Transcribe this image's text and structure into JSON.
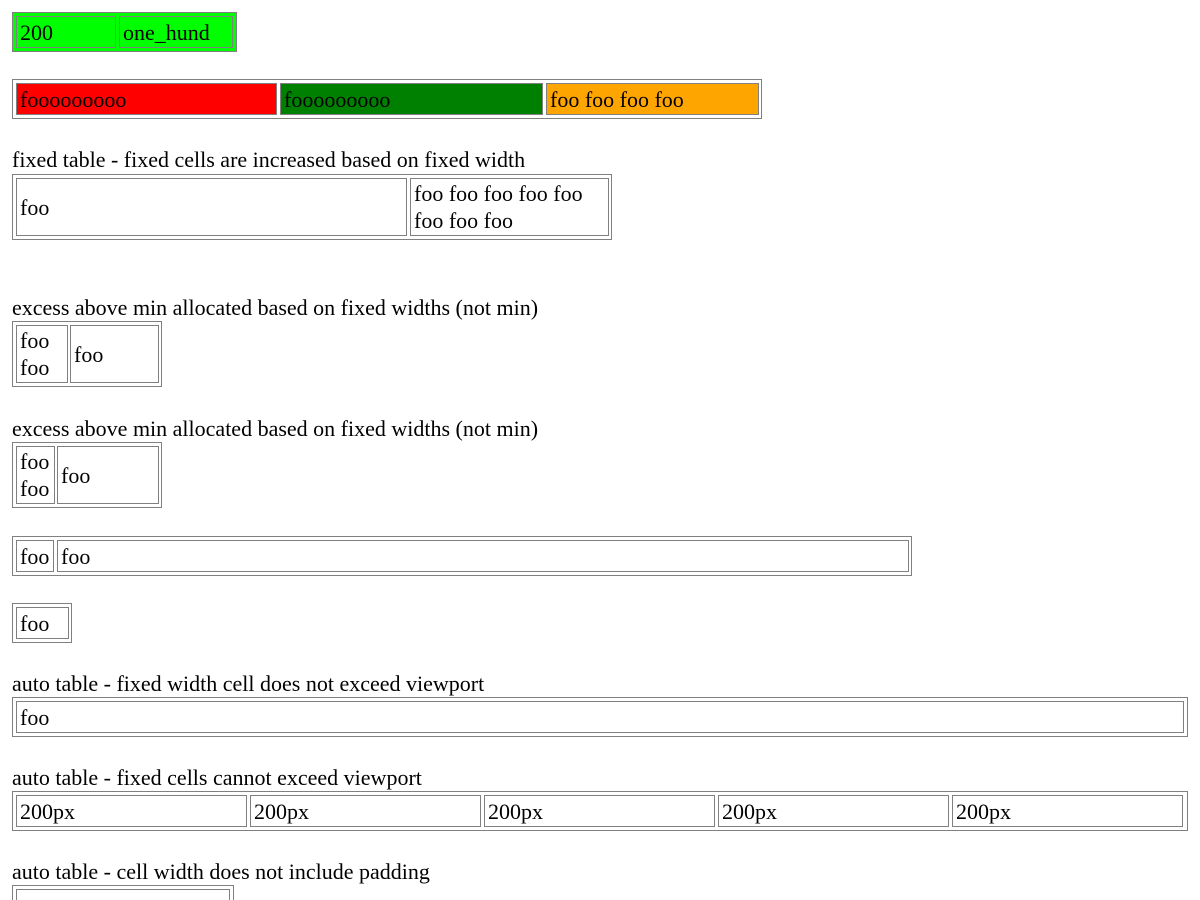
{
  "tables": {
    "t1": {
      "color": "#00ff00",
      "cells": [
        "200",
        "one_hund"
      ]
    },
    "t2": {
      "colors": [
        "#ff0000",
        "#008000",
        "#ffa500"
      ],
      "cells": [
        "fooooooooo",
        "fooooooooo",
        "foo foo foo foo"
      ]
    },
    "t3": {
      "caption": "fixed table - fixed cells are increased based on fixed width",
      "cells": [
        "foo",
        "foo foo foo foo foo\nfoo foo foo"
      ]
    },
    "t4": {
      "caption": "excess above min allocated based on fixed widths (not min)",
      "cells": [
        "foo\nfoo",
        "foo"
      ]
    },
    "t5": {
      "caption": "excess above min allocated based on fixed widths (not min)",
      "cells": [
        "foo\nfoo",
        "foo"
      ]
    },
    "t6": {
      "cells": [
        "foo",
        "foo"
      ]
    },
    "t7": {
      "cells": [
        "foo"
      ]
    },
    "t8": {
      "caption": "auto table - fixed width cell does not exceed viewport",
      "cells": [
        "foo"
      ]
    },
    "t9": {
      "caption": "auto table - fixed cells cannot exceed viewport",
      "cells": [
        "200px",
        "200px",
        "200px",
        "200px",
        "200px"
      ]
    },
    "t10": {
      "caption": "auto table - cell width does not include padding"
    }
  }
}
